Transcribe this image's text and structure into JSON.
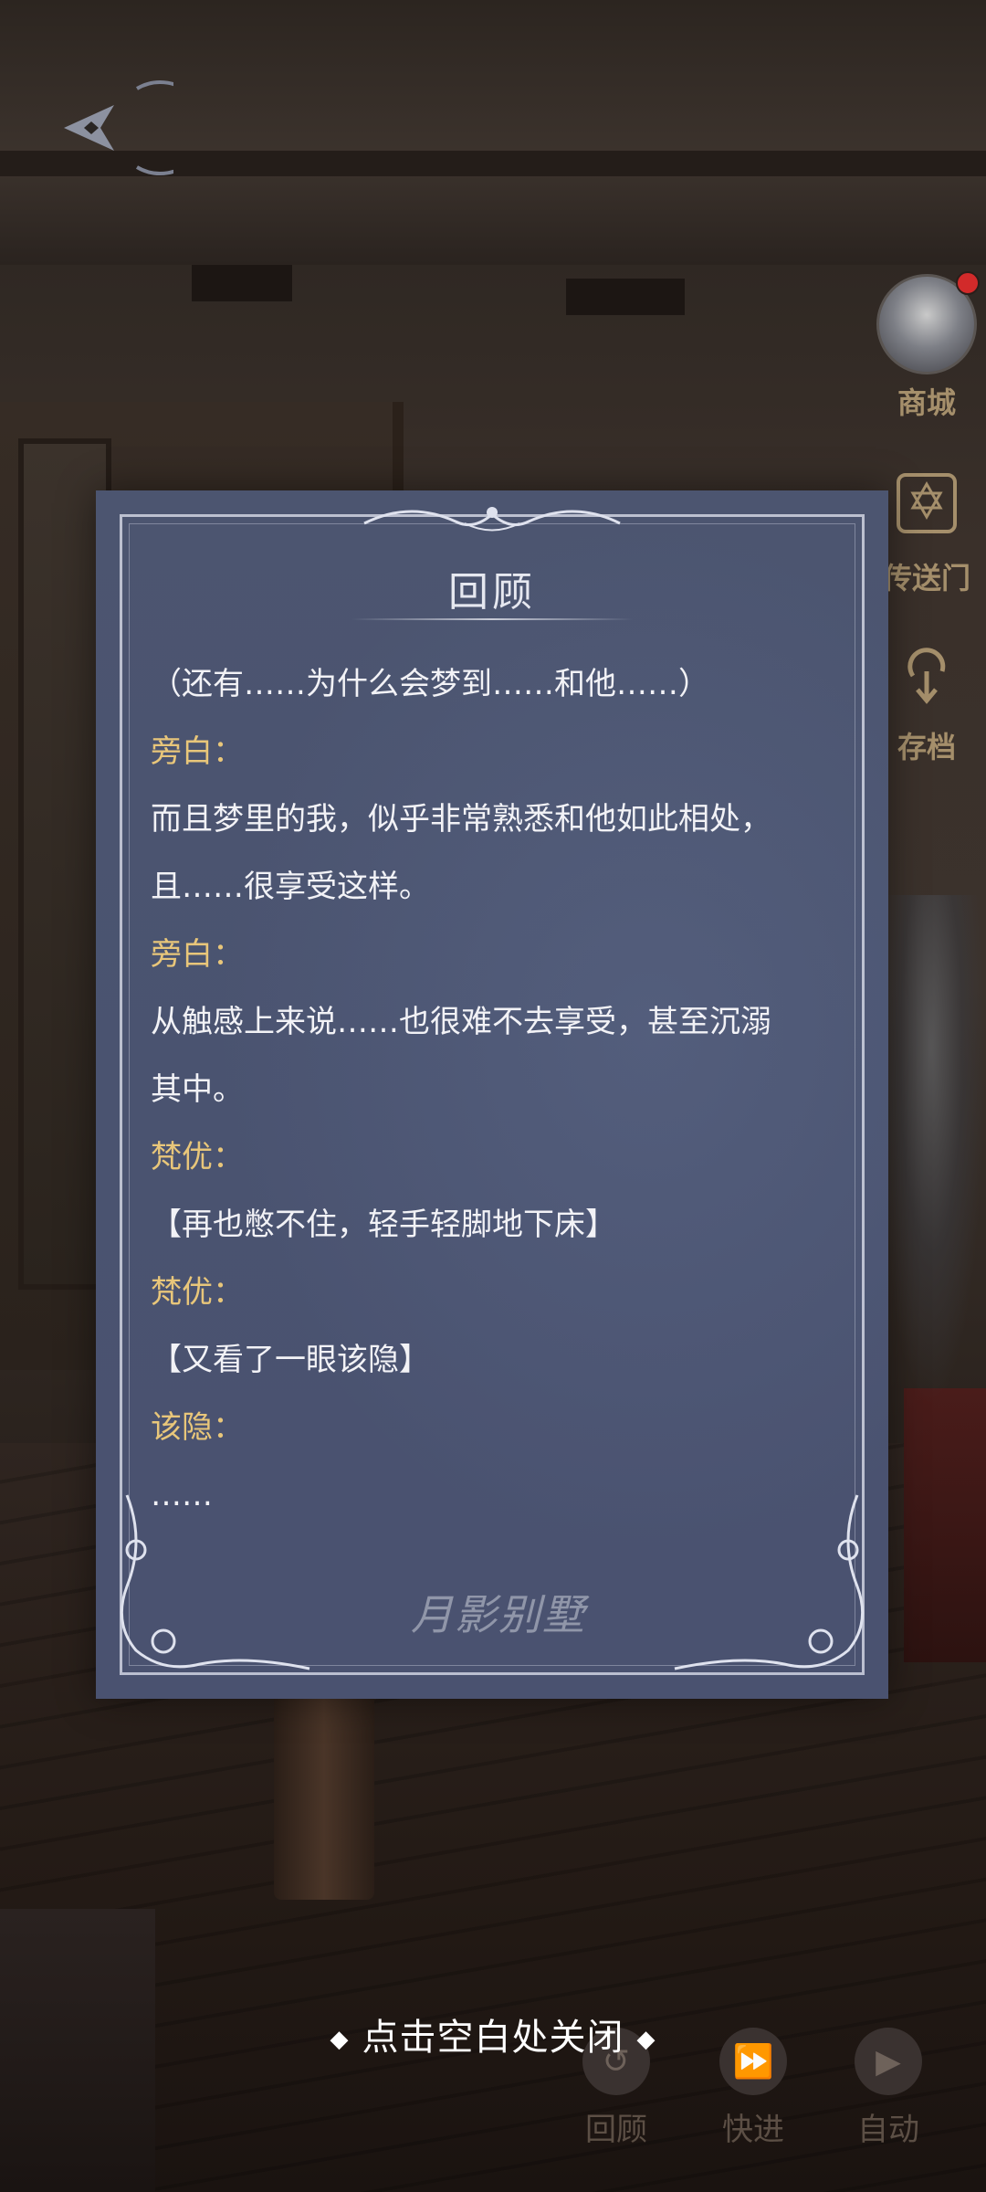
{
  "panel": {
    "title": "回顾",
    "entries": [
      {
        "type": "line",
        "text": "（还有……为什么会梦到……和他……）"
      },
      {
        "type": "speaker",
        "text": "旁白："
      },
      {
        "type": "line",
        "text": "而且梦里的我，似乎非常熟悉和他如此相处，"
      },
      {
        "type": "line",
        "text": "且……很享受这样。"
      },
      {
        "type": "speaker",
        "text": "旁白："
      },
      {
        "type": "line",
        "text": "从触感上来说……也很难不去享受，甚至沉溺"
      },
      {
        "type": "line",
        "text": "其中。"
      },
      {
        "type": "speaker",
        "text": "梵优："
      },
      {
        "type": "line",
        "text": "【再也憋不住，轻手轻脚地下床】"
      },
      {
        "type": "speaker",
        "text": "梵优："
      },
      {
        "type": "line",
        "text": "【又看了一眼该隐】"
      },
      {
        "type": "speaker",
        "text": "该隐："
      },
      {
        "type": "line",
        "text": "……"
      }
    ],
    "watermark": "月影别墅"
  },
  "side_menu": {
    "shop": "商城",
    "portal": "传送门",
    "save": "存档"
  },
  "controls": {
    "review": "回顾",
    "fast_forward": "快进",
    "auto": "自动"
  },
  "close_hint": "点击空白处关闭",
  "colors": {
    "panel_bg": "#4a5370",
    "speaker_name": "#e8c67a",
    "dialogue_text": "#f2f2f6",
    "side_label": "#a58f6b"
  },
  "icons": {
    "back": "back-arrow-diamond-icon",
    "portal": "hexagram-gate-icon",
    "save": "save-archive-icon",
    "review": "review-rewind-icon",
    "fast_forward": "fast-forward-icon",
    "auto": "play-icon"
  }
}
